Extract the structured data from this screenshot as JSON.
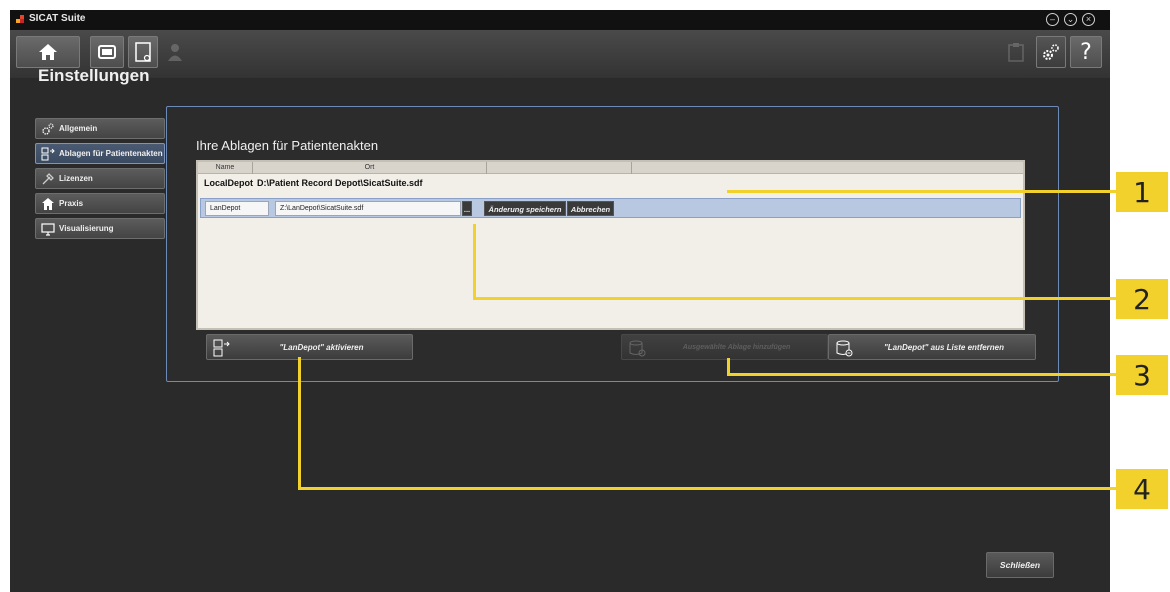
{
  "window": {
    "app_title": "SICAT Suite",
    "controls": [
      "minimize-icon",
      "restore-icon",
      "close-icon"
    ]
  },
  "toolbar": {
    "left_icons": [
      "home-icon",
      "patient-records-icon",
      "new-document-icon",
      "user-icon"
    ],
    "right_icons": [
      "clipboard-icon",
      "settings-icon",
      "help-icon"
    ],
    "help_label": "?"
  },
  "page": {
    "title": "Einstellungen"
  },
  "sidebar": {
    "items": [
      {
        "label": "Allgemein",
        "icon": "gears-icon",
        "active": false
      },
      {
        "label": "Ablagen für Patientenakten",
        "icon": "storage-icon",
        "active": true
      },
      {
        "label": "Lizenzen",
        "icon": "key-icon",
        "active": false
      },
      {
        "label": "Praxis",
        "icon": "house-icon",
        "active": false
      },
      {
        "label": "Visualisierung",
        "icon": "monitor-icon",
        "active": false
      }
    ]
  },
  "main": {
    "section_title": "Ihre Ablagen für Patientenakten",
    "table": {
      "columns": [
        "Name",
        "Ort",
        "",
        ""
      ],
      "rows": [
        {
          "name": "LocalDepot",
          "location": "D:\\Patient Record Depot\\SicatSuite.sdf"
        }
      ],
      "edit_row": {
        "name_value": "LanDepot",
        "location_value": "Z:\\LanDepot\\SicatSuite.sdf",
        "browse_label": "...",
        "save_label": "Änderung speichern",
        "cancel_label": "Abbrechen"
      }
    },
    "buttons": {
      "activate_label": "\"LanDepot\" aktivieren",
      "add_label": "Ausgewählte Ablage hinzufügen",
      "remove_label": "\"LanDepot\" aus Liste entfernen"
    }
  },
  "footer": {
    "close_label": "Schließen"
  },
  "callouts": [
    "1",
    "2",
    "3",
    "4"
  ],
  "colors": {
    "accent_blue": "#6d8bb8",
    "callout_yellow": "#f2d12c",
    "background": "#2a2a2a"
  }
}
